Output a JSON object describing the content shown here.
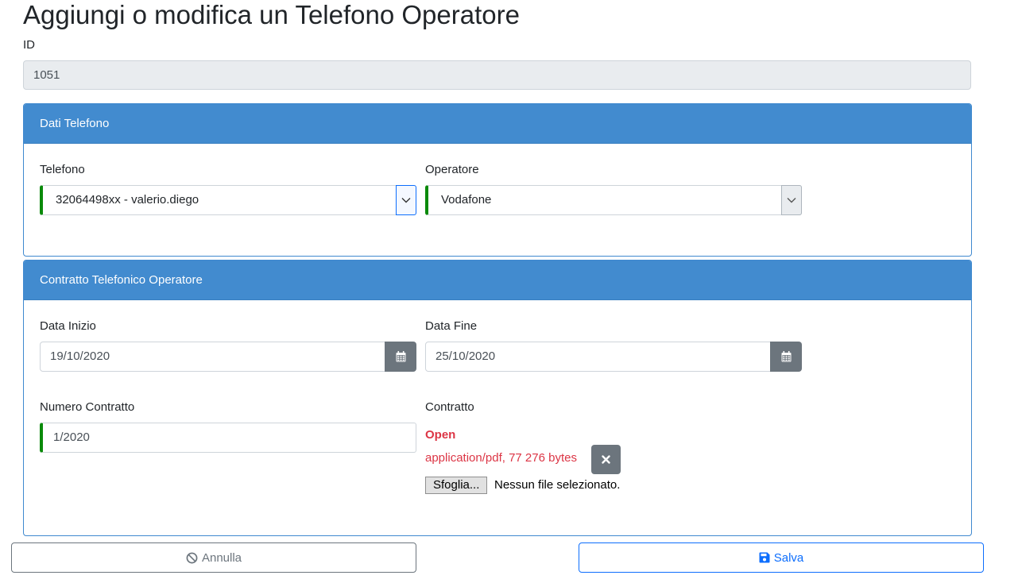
{
  "page": {
    "title": "Aggiungi o modifica un Telefono Operatore"
  },
  "id_field": {
    "label": "ID",
    "value": "1051"
  },
  "phone_card": {
    "header": "Dati Telefono",
    "telefono": {
      "label": "Telefono",
      "value": "32064498xx - valerio.diego"
    },
    "operatore": {
      "label": "Operatore",
      "value": "Vodafone"
    }
  },
  "contract_card": {
    "header": "Contratto Telefonico Operatore",
    "data_inizio": {
      "label": "Data Inizio",
      "value": "19/10/2020"
    },
    "data_fine": {
      "label": "Data Fine",
      "value": "25/10/2020"
    },
    "numero_contratto": {
      "label": "Numero Contratto",
      "value": "1/2020"
    },
    "contratto": {
      "label": "Contratto",
      "open_link": "Open",
      "file_info": "application/pdf, 77 276 bytes",
      "browse_label": "Sfoglia...",
      "no_file_text": "Nessun file selezionato."
    }
  },
  "actions": {
    "cancel_label": "Annulla",
    "save_label": "Salva"
  },
  "icons": {
    "select_chevron": "chevron-down-icon",
    "calendar": "calendar-icon",
    "remove": "close-icon",
    "cancel": "ban-icon",
    "save": "floppy-disk-icon"
  },
  "colors": {
    "card_header": "#428bcf",
    "valid_border": "#0a8a0a",
    "danger": "#dc3545",
    "primary": "#0d6efd",
    "secondary": "#6c757d"
  }
}
